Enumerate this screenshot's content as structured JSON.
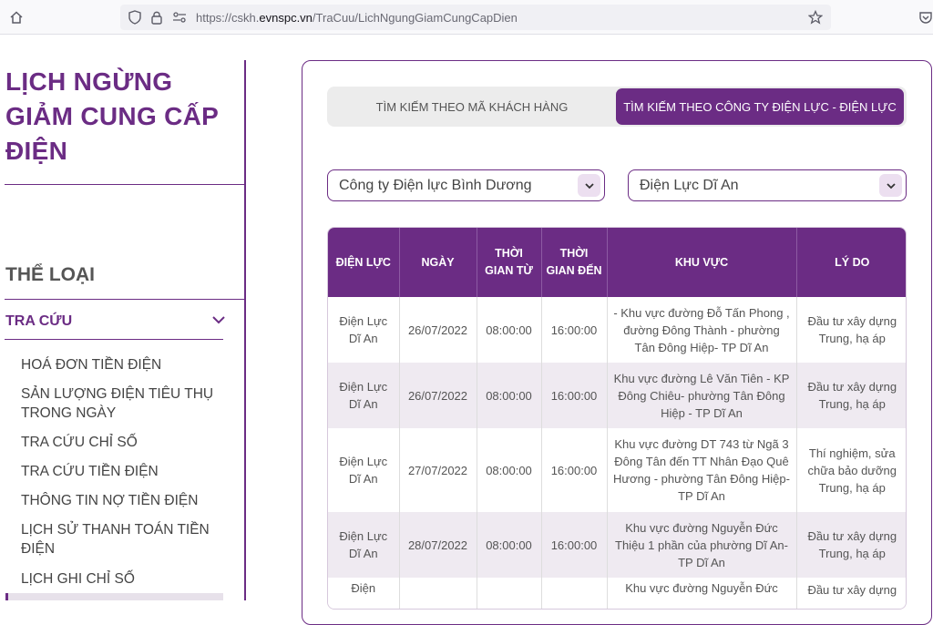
{
  "browser": {
    "url_prefix": "https://cskh.",
    "url_host": "evnspc.vn",
    "url_path": "/TraCuu/LichNgungGiamCungCapDien"
  },
  "page": {
    "title": "LỊCH NGỪNG GIẢM CUNG CẤP ĐIỆN"
  },
  "sidebar": {
    "category_title": "THỂ LOẠI",
    "section_label": "TRA CỨU",
    "items": [
      {
        "label": "HOÁ ĐƠN TIỀN ĐIỆN"
      },
      {
        "label": "SẢN LƯỢNG ĐIỆN TIÊU THỤ TRONG NGÀY"
      },
      {
        "label": "TRA CỨU CHỈ SỐ"
      },
      {
        "label": "TRA CỨU TIỀN ĐIỆN"
      },
      {
        "label": "THÔNG TIN NỢ TIỀN ĐIỆN"
      },
      {
        "label": "LỊCH SỬ THANH TOÁN TIỀN ĐIỆN"
      },
      {
        "label": "LỊCH GHI CHỈ SỐ"
      }
    ]
  },
  "search": {
    "tab_customer": "TÌM KIẾM THEO MÃ KHÁCH HÀNG",
    "tab_company": "TÌM KIẾM THEO CÔNG TY ĐIỆN LỰC - ĐIỆN LỰC",
    "company_value": "Công ty Điện lực Bình Dương",
    "district_value": "Điện Lực Dĩ An"
  },
  "table": {
    "headers": {
      "dienluc": "ĐIỆN LỰC",
      "ngay": "NGÀY",
      "tu": "THỜI GIAN TỪ",
      "den": "THỜI GIAN ĐẾN",
      "khuvuc": "KHU VỰC",
      "lydo": "LÝ DO"
    },
    "rows": [
      {
        "dienluc": "Điện Lực Dĩ An",
        "ngay": "26/07/2022",
        "tu": "08:00:00",
        "den": "16:00:00",
        "khuvuc": "- Khu vực đường Đỗ Tấn Phong , đường Đông Thành - phường Tân Đông Hiệp- TP Dĩ An",
        "lydo": "Đầu tư xây dựng Trung, hạ áp"
      },
      {
        "dienluc": "Điện Lực Dĩ An",
        "ngay": "26/07/2022",
        "tu": "08:00:00",
        "den": "16:00:00",
        "khuvuc": "Khu vực đường Lê Văn Tiên - KP Đông Chiêu- phường Tân Đông Hiệp - TP Dĩ An",
        "lydo": "Đầu tư xây dựng Trung, hạ áp"
      },
      {
        "dienluc": "Điện Lực Dĩ An",
        "ngay": "27/07/2022",
        "tu": "08:00:00",
        "den": "16:00:00",
        "khuvuc": "Khu vực đường DT 743 từ Ngã 3 Đông Tân đến TT Nhân Đạo Quê Hương - phường Tân Đông Hiệp- TP Dĩ An",
        "lydo": "Thí nghiệm, sửa chữa bảo dưỡng Trung, hạ áp"
      },
      {
        "dienluc": "Điện Lực Dĩ An",
        "ngay": "28/07/2022",
        "tu": "08:00:00",
        "den": "16:00:00",
        "khuvuc": "Khu vực đường Nguyễn Đức Thiệu 1 phần của phường Dĩ An- TP Dĩ An",
        "lydo": "Đầu tư xây dựng Trung, hạ áp"
      },
      {
        "dienluc": "Điện",
        "ngay": "",
        "tu": "",
        "den": "",
        "khuvuc": "Khu vực đường Nguyễn Đức",
        "lydo": "Đầu tư xây dựng"
      }
    ]
  },
  "colors": {
    "accent": "#6b2c84",
    "row_alt": "#efeaf1"
  }
}
